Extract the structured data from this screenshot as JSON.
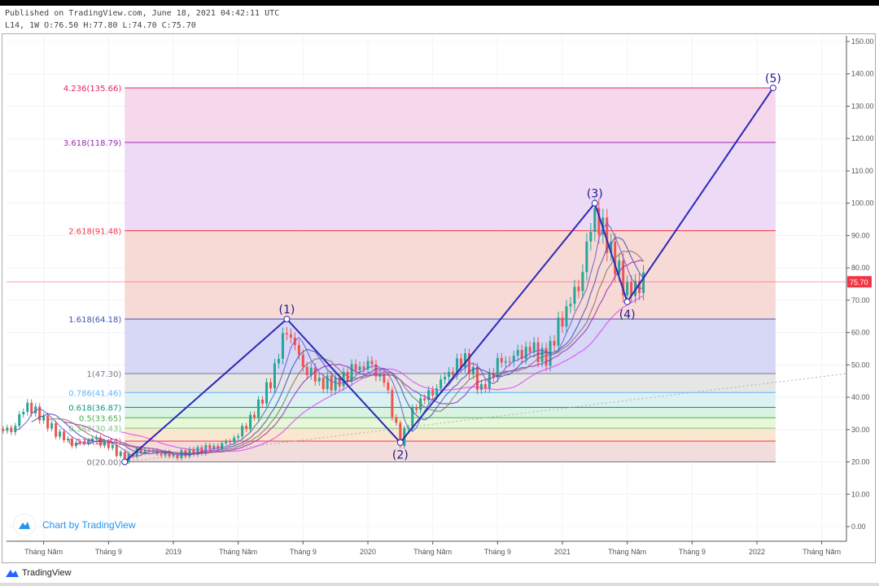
{
  "header": {
    "published": "Published on TradingView.com, June 18, 2021 04:42:11 UTC",
    "ohlc": "L14, 1W O:76.50 H:77.80 L:74.70 C:75.70"
  },
  "watermark": "Chart by TradingView",
  "footer_brand": "TradingView",
  "colors": {
    "wave": "#2a2ab8",
    "up": "#26a69a",
    "down": "#ef5350",
    "last_price": "#f23645"
  },
  "chart_data": {
    "type": "candlestick",
    "title": "",
    "interval": "1W",
    "ylim": [
      0,
      150
    ],
    "y_ticks": [
      "0.00",
      "10.00",
      "20.00",
      "30.00",
      "40.00",
      "50.00",
      "60.00",
      "70.00",
      "80.00",
      "90.00",
      "100.00",
      "110.00",
      "120.00",
      "130.00",
      "140.00",
      "150.00"
    ],
    "x_range": [
      "2018-03",
      "2022-06"
    ],
    "x_ticks": [
      {
        "date": "2018-05",
        "label": "Tháng Năm"
      },
      {
        "date": "2018-09",
        "label": "Tháng 9"
      },
      {
        "date": "2019-01",
        "label": "2019"
      },
      {
        "date": "2019-05",
        "label": "Tháng Năm"
      },
      {
        "date": "2019-09",
        "label": "Tháng 9"
      },
      {
        "date": "2020-01",
        "label": "2020"
      },
      {
        "date": "2020-05",
        "label": "Tháng Năm"
      },
      {
        "date": "2020-09",
        "label": "Tháng 9"
      },
      {
        "date": "2021-01",
        "label": "2021"
      },
      {
        "date": "2021-05",
        "label": "Tháng Năm"
      },
      {
        "date": "2021-09",
        "label": "Tháng 9"
      },
      {
        "date": "2022-01",
        "label": "2022"
      },
      {
        "date": "2022-05",
        "label": "Tháng Năm"
      }
    ],
    "last_price": "75.70",
    "price_path": [
      {
        "date": "2018-03",
        "close": 30
      },
      {
        "date": "2018-04",
        "close": 38
      },
      {
        "date": "2018-05",
        "close": 33
      },
      {
        "date": "2018-06",
        "close": 28
      },
      {
        "date": "2018-07",
        "close": 25
      },
      {
        "date": "2018-08",
        "close": 27
      },
      {
        "date": "2018-09",
        "close": 25
      },
      {
        "date": "2018-10",
        "close": 21
      },
      {
        "date": "2018-11",
        "close": 24
      },
      {
        "date": "2018-12",
        "close": 23
      },
      {
        "date": "2019-01",
        "close": 22
      },
      {
        "date": "2019-02",
        "close": 23
      },
      {
        "date": "2019-03",
        "close": 24
      },
      {
        "date": "2019-04",
        "close": 25
      },
      {
        "date": "2019-05",
        "close": 28
      },
      {
        "date": "2019-06",
        "close": 35
      },
      {
        "date": "2019-07",
        "close": 45
      },
      {
        "date": "2019-08",
        "close": 62
      },
      {
        "date": "2019-09",
        "close": 50
      },
      {
        "date": "2019-10",
        "close": 45
      },
      {
        "date": "2019-11",
        "close": 44
      },
      {
        "date": "2019-12",
        "close": 48
      },
      {
        "date": "2020-01",
        "close": 50
      },
      {
        "date": "2020-02",
        "close": 45
      },
      {
        "date": "2020-03",
        "close": 26
      },
      {
        "date": "2020-04",
        "close": 38
      },
      {
        "date": "2020-05",
        "close": 42
      },
      {
        "date": "2020-06",
        "close": 48
      },
      {
        "date": "2020-07",
        "close": 52
      },
      {
        "date": "2020-08",
        "close": 42
      },
      {
        "date": "2020-09",
        "close": 50
      },
      {
        "date": "2020-10",
        "close": 52
      },
      {
        "date": "2020-11",
        "close": 55
      },
      {
        "date": "2020-12",
        "close": 52
      },
      {
        "date": "2021-01",
        "close": 65
      },
      {
        "date": "2021-02",
        "close": 75
      },
      {
        "date": "2021-03",
        "close": 98
      },
      {
        "date": "2021-04",
        "close": 85
      },
      {
        "date": "2021-05",
        "close": 72
      },
      {
        "date": "2021-06",
        "close": 75.7
      }
    ],
    "elliott_wave": [
      {
        "label": "",
        "date": "2018-10",
        "value": 20.0
      },
      {
        "label": "(1)",
        "date": "2019-08",
        "value": 64.18
      },
      {
        "label": "(2)",
        "date": "2020-03",
        "value": 26.0
      },
      {
        "label": "(3)",
        "date": "2021-03",
        "value": 100.0
      },
      {
        "label": "(4)",
        "date": "2021-05",
        "value": 69.5
      },
      {
        "label": "(5)",
        "date": "2022-02",
        "value": 135.66
      }
    ],
    "fib_extension": {
      "start_date": "2018-10",
      "end_date": "2022-02",
      "levels": [
        {
          "label": "0(20.00)",
          "value": 20.0,
          "color": "#787b86",
          "fill": "#f0d6d6"
        },
        {
          "label": "0.236(26.44)",
          "value": 26.44,
          "color": "#f23645",
          "fill": "#f9e3c8"
        },
        {
          "label": "0.382(30.43)",
          "value": 30.43,
          "color": "#81c784",
          "fill": "#e4f4d4"
        },
        {
          "label": "0.5(33.65)",
          "value": 33.65,
          "color": "#4caf50",
          "fill": "#d3f0dc"
        },
        {
          "label": "0.618(36.87)",
          "value": 36.87,
          "color": "#089981",
          "fill": "#d6eef0"
        },
        {
          "label": "0.786(41.46)",
          "value": 41.46,
          "color": "#64b5f6",
          "fill": "#e2e2e2"
        },
        {
          "label": "1(47.30)",
          "value": 47.3,
          "color": "#787b86",
          "fill": "#d0d0f4"
        },
        {
          "label": "1.618(64.18)",
          "value": 64.18,
          "color": "#3f51b5",
          "fill": "#f6d3cf"
        },
        {
          "label": "2.618(91.48)",
          "value": 91.48,
          "color": "#f23645",
          "fill": "#ead4f4"
        },
        {
          "label": "3.618(118.79)",
          "value": 118.79,
          "color": "#9c27b0",
          "fill": "#f3d1e8"
        },
        {
          "label": "4.236(135.66)",
          "value": 135.66,
          "color": "#e91e63",
          "fill": null
        }
      ]
    }
  }
}
